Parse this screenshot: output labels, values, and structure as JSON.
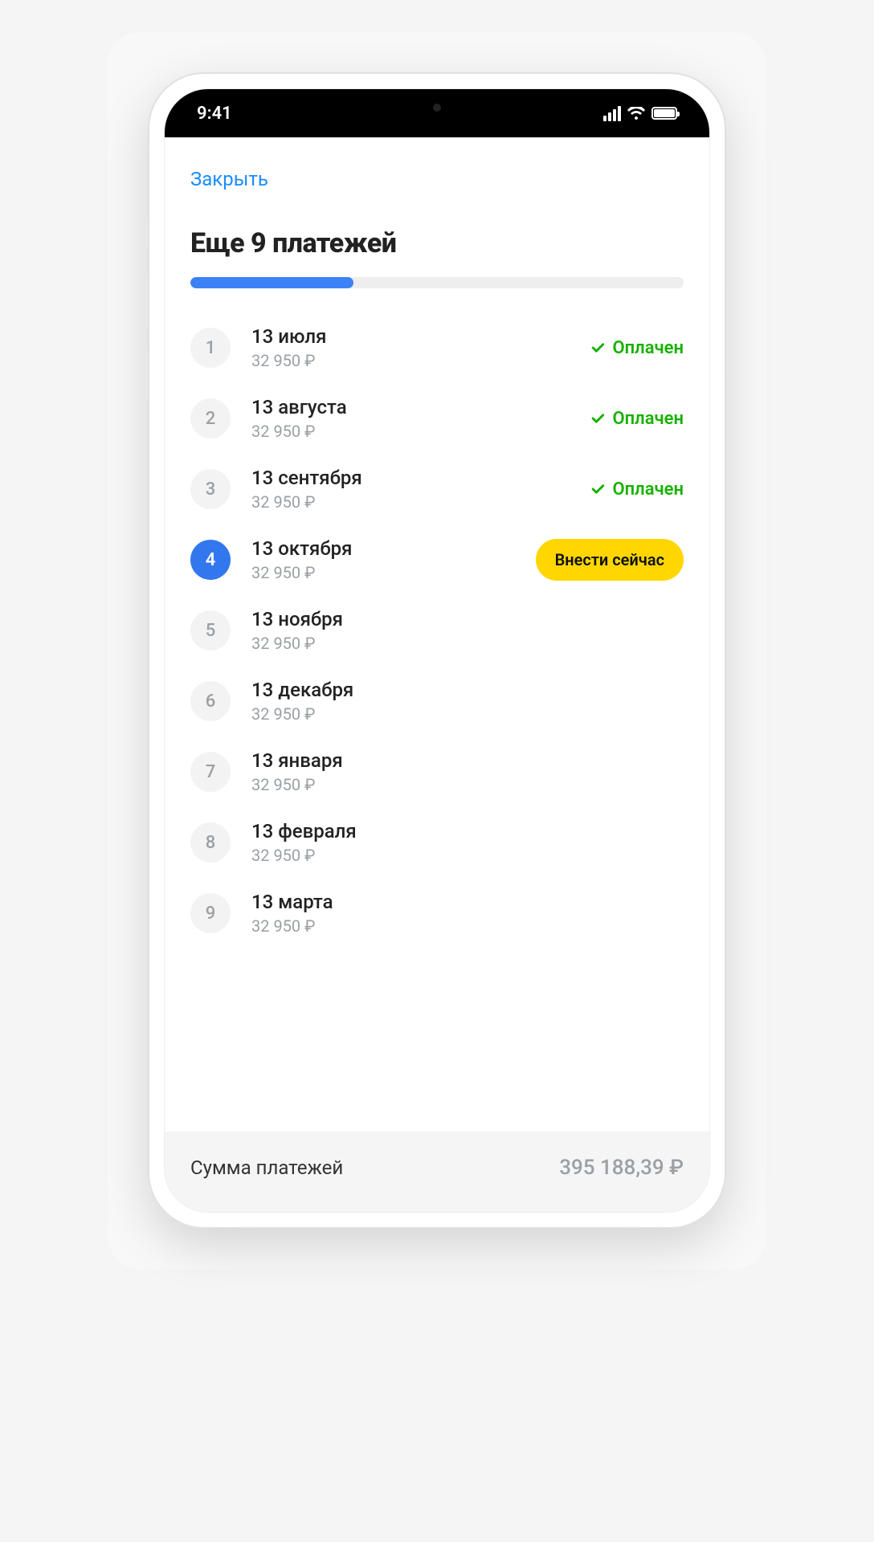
{
  "status_bar": {
    "time": "9:41"
  },
  "header": {
    "close_label": "Закрыть",
    "title": "Еще 9 платежей"
  },
  "progress": {
    "percent": 33
  },
  "status_labels": {
    "paid": "Оплачен",
    "pay_now": "Внести сейчас"
  },
  "payments": [
    {
      "num": "1",
      "date": "13 июля",
      "amount": "32 950 ₽",
      "state": "paid"
    },
    {
      "num": "2",
      "date": "13 августа",
      "amount": "32 950 ₽",
      "state": "paid"
    },
    {
      "num": "3",
      "date": "13 сентября",
      "amount": "32 950 ₽",
      "state": "paid"
    },
    {
      "num": "4",
      "date": "13 октября",
      "amount": "32 950 ₽",
      "state": "current"
    },
    {
      "num": "5",
      "date": "13 ноября",
      "amount": "32 950 ₽",
      "state": "future"
    },
    {
      "num": "6",
      "date": "13 декабря",
      "amount": "32 950 ₽",
      "state": "future"
    },
    {
      "num": "7",
      "date": "13 января",
      "amount": "32 950 ₽",
      "state": "future"
    },
    {
      "num": "8",
      "date": "13 февраля",
      "amount": "32 950 ₽",
      "state": "future"
    },
    {
      "num": "9",
      "date": "13 марта",
      "amount": "32 950 ₽",
      "state": "future"
    }
  ],
  "summary": {
    "label": "Сумма платежей",
    "value": "395 188,39 ₽"
  }
}
